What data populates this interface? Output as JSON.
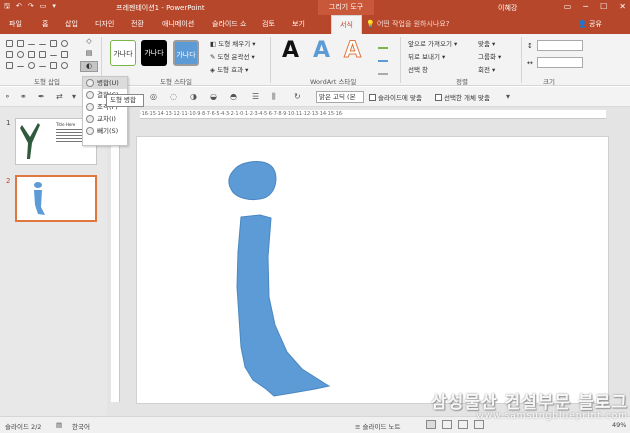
{
  "colors": {
    "accent": "#b7472a",
    "shape_fill": "#5c9bd5",
    "shape_stroke": "#4a87c0",
    "selected_thumb": "#e0773f"
  },
  "titlebar": {
    "qat_icons": [
      "save-icon",
      "undo-icon",
      "redo-icon",
      "start-icon",
      "customize-icon"
    ],
    "qat_glyphs": [
      "🖫",
      "↶",
      "↷",
      "▭",
      "▾"
    ],
    "doc_title": "프레젠테이션1 - PowerPoint",
    "context_tab": "그리기 도구",
    "user": "이혜강",
    "window_glyphs": [
      "▭",
      "─",
      "☐",
      "✕"
    ]
  },
  "ribbon_tabs": [
    {
      "label": "파일",
      "active": false
    },
    {
      "label": "홈",
      "active": false
    },
    {
      "label": "삽입",
      "active": false
    },
    {
      "label": "디자인",
      "active": false
    },
    {
      "label": "전환",
      "active": false
    },
    {
      "label": "애니메이션",
      "active": false
    },
    {
      "label": "슬라이드 쇼",
      "active": false
    },
    {
      "label": "검토",
      "active": false
    },
    {
      "label": "보기",
      "active": false
    },
    {
      "label": "서식",
      "active": true
    }
  ],
  "tell_me": "어떤 작업을 원하시나요?",
  "share": "공유",
  "ribbon": {
    "groups": {
      "insert_shapes": "도형 삽입",
      "shape_styles": "도형 스타일",
      "wordart_styles": "WordArt 스타일",
      "arrange": "정렬",
      "size": "크기"
    },
    "style_sample_text": "가나다",
    "shape_style_options": [
      "도형 채우기 ▾",
      "도형 윤곽선 ▾",
      "도형 효과 ▾"
    ],
    "wordart_letter": "A",
    "arrange_left": [
      "앞으로 가져오기 ▾",
      "뒤로 보내기 ▾",
      "선택 창"
    ],
    "arrange_right": [
      "맞춤 ▾",
      "그룹화 ▾",
      "회전 ▾"
    ]
  },
  "quick_toolbar": {
    "font": "맑은 고딕 (본",
    "fit_slide": "슬라이드에 맞춤",
    "selected_objects": "선택한 개체 맞춤"
  },
  "merge_menu": {
    "items": [
      {
        "label": "병합(U)",
        "icon": "union-icon"
      },
      {
        "label": "결합(C)",
        "icon": "combine-icon"
      },
      {
        "label": "조각(F)",
        "icon": "fragment-icon"
      },
      {
        "label": "교차(I)",
        "icon": "intersect-icon"
      },
      {
        "label": "빼기(S)",
        "icon": "subtract-icon"
      }
    ],
    "tooltip": "도형 병합"
  },
  "thumbnails": [
    {
      "number": "1",
      "title": "Title Here",
      "selected": false
    },
    {
      "number": "2",
      "title": "",
      "selected": true
    }
  ],
  "ruler_text": "·16·15·14·13·12·11·10·9·8·7·6·5·4·3·2·1·0·1·2·3·4·5·6·7·8·9·10·11·12·13·14·15·16·",
  "statusbar": {
    "slide_info": "슬라이드 2/2",
    "language": "한국어",
    "notes": "슬라이드 노트",
    "zoom": "49%"
  },
  "watermark": {
    "line1": "삼성물산 건설부문 블로그",
    "line2": "www.samsungblueprint.com"
  }
}
